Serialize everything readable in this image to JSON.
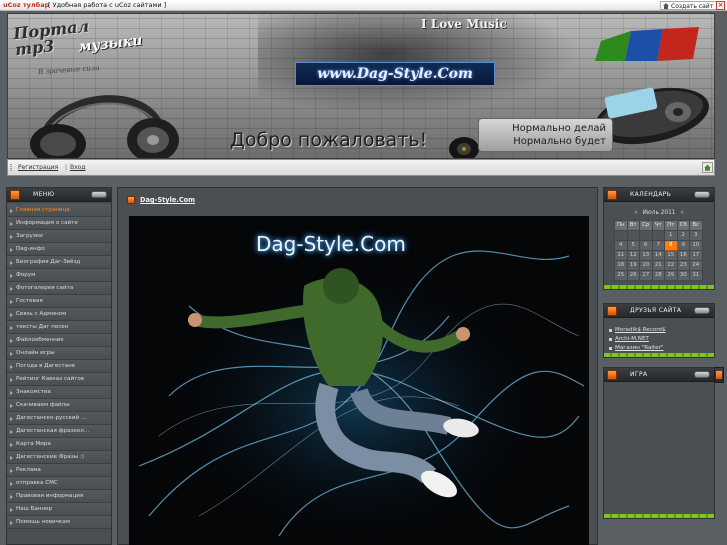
{
  "toolbar": {
    "brand": "uCoz тулбар",
    "promo": "[ Удобная работа с uCoz сайтами ]",
    "create_site": "Создать сайт"
  },
  "banner": {
    "portal_line1": "Портал mp3",
    "portal_line2": "музыки",
    "portal_sub": "В зрачевые сила",
    "i_love_music": "I Love Music",
    "site_logo": "www.Dag-Style.Com",
    "welcome": "Добро пожаловать!",
    "motto_line1": "Нормально делай",
    "motto_line2": "Нормально будет"
  },
  "nav": {
    "register": "Регистрация",
    "login": "Вход"
  },
  "menu": {
    "title": "МЕНЮ",
    "items": [
      {
        "label": "Главная страница",
        "active": true
      },
      {
        "label": "Информация о сайте"
      },
      {
        "label": "Загрузки"
      },
      {
        "label": "Dag-инфо"
      },
      {
        "label": "Биография Даг-Звёзд"
      },
      {
        "label": "Форум"
      },
      {
        "label": "Фотогалерея сайта"
      },
      {
        "label": "Гостевая"
      },
      {
        "label": "Связь с Админом"
      },
      {
        "label": "тексты Даг песен"
      },
      {
        "label": "Файлообменник"
      },
      {
        "label": "Онлайн игры"
      },
      {
        "label": "Погода в Дагестане"
      },
      {
        "label": "Рейтинг Кавказ сайтов"
      },
      {
        "label": "Знакомства"
      },
      {
        "label": "Скачиваем файлы"
      },
      {
        "label": "Дагестанско-русский ..."
      },
      {
        "label": "Дагестанская фразеол..."
      },
      {
        "label": "Карта Мира"
      },
      {
        "label": "Дагестанские Фразы :)"
      },
      {
        "label": "Реклама"
      },
      {
        "label": "отправка СМС"
      },
      {
        "label": "Правовая информация"
      },
      {
        "label": "Наш Баннер"
      },
      {
        "label": "Помощь новичкам"
      }
    ]
  },
  "main": {
    "post_title": "Dag-Style.Com",
    "art_logo": "Dag-Style.Com"
  },
  "calendar": {
    "title": "КАЛЕНДАРЬ",
    "prev": "«",
    "month": "Июль 2011",
    "next": "»",
    "weekdays": [
      "Пн",
      "Вт",
      "Ср",
      "Чт",
      "Пт",
      "Сб",
      "Вс"
    ],
    "weeks": [
      [
        "",
        "",
        "",
        "",
        "1",
        "2",
        "3"
      ],
      [
        "4",
        "5",
        "6",
        "7",
        "8",
        "9",
        "10"
      ],
      [
        "11",
        "12",
        "13",
        "14",
        "15",
        "16",
        "17"
      ],
      [
        "18",
        "19",
        "20",
        "21",
        "22",
        "23",
        "24"
      ],
      [
        "25",
        "26",
        "27",
        "28",
        "29",
        "30",
        "31"
      ]
    ],
    "today": "8"
  },
  "friends": {
    "title": "ДРУЗЬЯ САЙТА",
    "links": [
      "Moradik$ Record$",
      "Archi-M.NET",
      "Магазин \"Raiter\""
    ]
  },
  "game": {
    "title": "ИГРА"
  },
  "colors": {
    "accent": "#ff7a12",
    "panel_bg": "#4a4f54",
    "page_bg": "#5a5f64",
    "footer_green": "#7ec51f"
  }
}
